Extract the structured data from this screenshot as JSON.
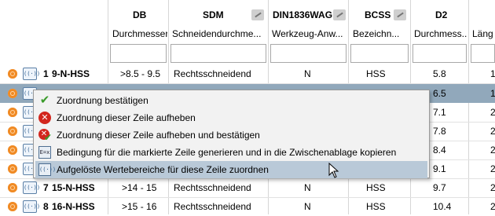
{
  "columns": [
    {
      "key": "db",
      "header": "DB",
      "subheader": "Durchmesser",
      "editable": false
    },
    {
      "key": "sdm",
      "header": "SDM",
      "subheader": "Schneidendurchme...",
      "editable": true
    },
    {
      "key": "din",
      "header": "DIN1836WAG",
      "subheader": "Werkzeug-Anw...",
      "editable": true
    },
    {
      "key": "bcss",
      "header": "BCSS",
      "subheader": "Bezeichn...",
      "editable": true
    },
    {
      "key": "d2",
      "header": "D2",
      "subheader": "Durchmess...",
      "editable": false
    },
    {
      "key": "l",
      "header": "",
      "subheader": "Läng",
      "editable": false
    }
  ],
  "rows": [
    {
      "num": "1",
      "id": "9-N-HSS",
      "db": ">8.5 - 9.5",
      "sdm": "Rechtsschneidend",
      "din": "N",
      "bcss": "HSS",
      "d2": "5.8",
      "l": "1",
      "selected": false
    },
    {
      "num": "",
      "id": "",
      "db": "",
      "sdm": "",
      "din": "",
      "bcss": "",
      "d2": "6.5",
      "l": "1",
      "selected": true
    },
    {
      "num": "",
      "id": "",
      "db": "",
      "sdm": "",
      "din": "",
      "bcss": "",
      "d2": "7.1",
      "l": "2",
      "selected": false
    },
    {
      "num": "",
      "id": "",
      "db": "",
      "sdm": "",
      "din": "",
      "bcss": "",
      "d2": "7.8",
      "l": "2",
      "selected": false
    },
    {
      "num": "",
      "id": "",
      "db": "",
      "sdm": "",
      "din": "",
      "bcss": "",
      "d2": "8.4",
      "l": "2",
      "selected": false
    },
    {
      "num": "",
      "id": "",
      "db": "",
      "sdm": "",
      "din": "",
      "bcss": "",
      "d2": "9.1",
      "l": "2",
      "selected": false
    },
    {
      "num": "7",
      "id": "15-N-HSS",
      "db": ">14 - 15",
      "sdm": "Rechtsschneidend",
      "din": "N",
      "bcss": "HSS",
      "d2": "9.7",
      "l": "2",
      "selected": false
    },
    {
      "num": "8",
      "id": "16-N-HSS",
      "db": ">15 - 16",
      "sdm": "Rechtsschneidend",
      "din": "N",
      "bcss": "HSS",
      "d2": "10.4",
      "l": "2",
      "selected": false
    }
  ],
  "row_icon_text": "((·))",
  "context_menu": {
    "items": [
      {
        "label": "Zuordnung bestätigen",
        "icon": "check-icon"
      },
      {
        "label": "Zuordnung dieser Zeile aufheben",
        "icon": "remove-icon"
      },
      {
        "label": "Zuordnung dieser Zeile aufheben und bestätigen",
        "icon": "remove-confirm-icon"
      },
      {
        "label": "Bedingung für die markierte Zeile generieren und in die Zwischenablage kopieren",
        "icon": "clipboard-expression-icon",
        "icon_text": "E=x"
      },
      {
        "label": "Aufgelöste Wertebereiche für diese Zeile zuordnen",
        "icon": "range-assign-icon",
        "icon_text": "((·))"
      }
    ],
    "hover_index": 4
  },
  "colors": {
    "selected_row": "#91a8bb",
    "menu_hover": "#b9c9d8",
    "gear": "#f08a24"
  }
}
